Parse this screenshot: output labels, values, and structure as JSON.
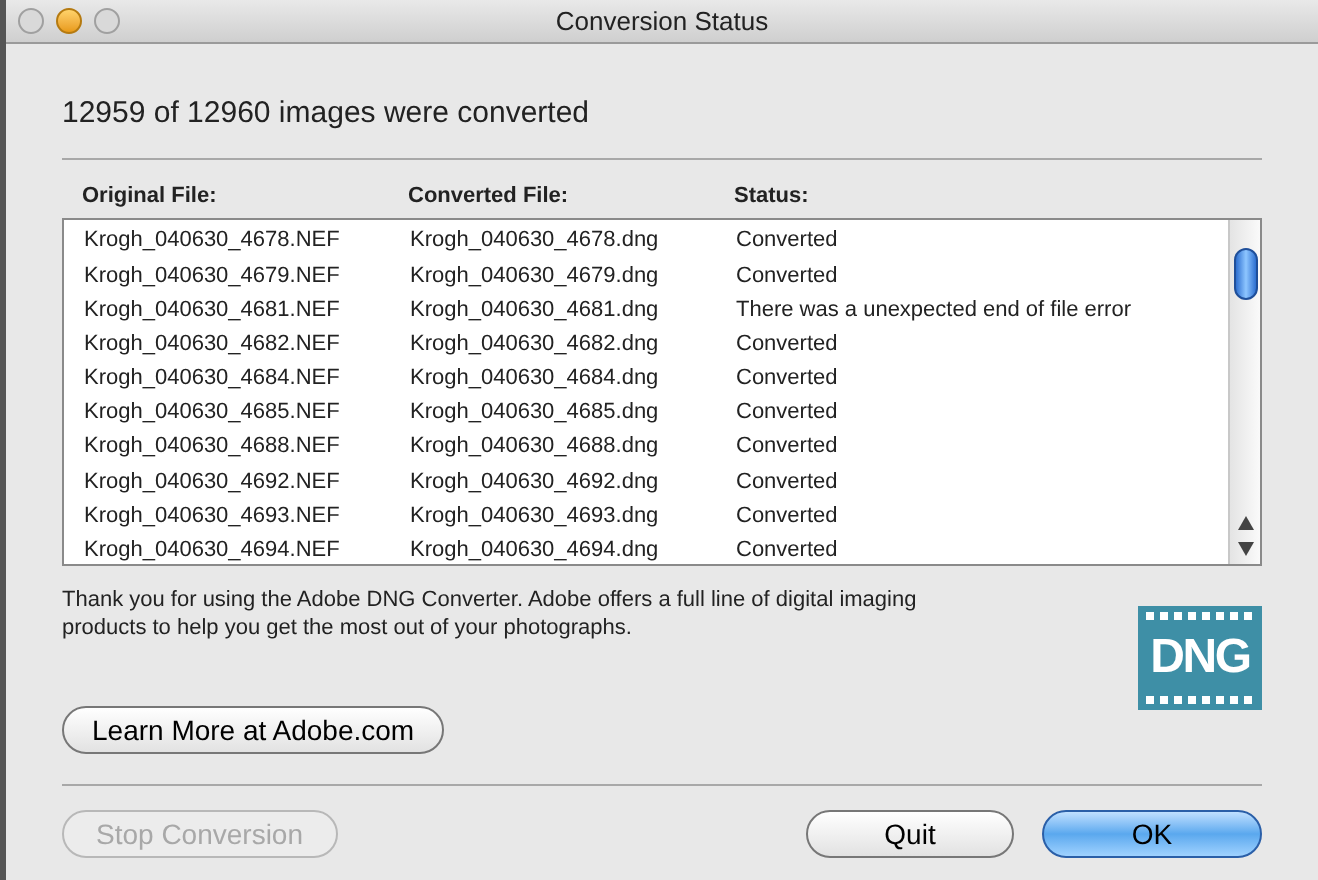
{
  "window": {
    "title": "Conversion Status"
  },
  "summary": "12959 of 12960 images were converted",
  "table": {
    "columns": [
      "Original File:",
      "Converted File:",
      "Status:"
    ],
    "rows": [
      [
        "Krogh_040630_4678.NEF",
        "Krogh_040630_4678.dng",
        "Converted"
      ],
      [
        "Krogh_040630_4679.NEF",
        "Krogh_040630_4679.dng",
        "Converted"
      ],
      [
        "Krogh_040630_4681.NEF",
        "Krogh_040630_4681.dng",
        "There was a unexpected end of file error"
      ],
      [
        "Krogh_040630_4682.NEF",
        "Krogh_040630_4682.dng",
        "Converted"
      ],
      [
        "Krogh_040630_4684.NEF",
        "Krogh_040630_4684.dng",
        "Converted"
      ],
      [
        "Krogh_040630_4685.NEF",
        "Krogh_040630_4685.dng",
        "Converted"
      ],
      [
        "Krogh_040630_4688.NEF",
        "Krogh_040630_4688.dng",
        "Converted"
      ],
      [
        "Krogh_040630_4692.NEF",
        "Krogh_040630_4692.dng",
        "Converted"
      ],
      [
        "Krogh_040630_4693.NEF",
        "Krogh_040630_4693.dng",
        "Converted"
      ],
      [
        "Krogh_040630_4694.NEF",
        "Krogh_040630_4694.dng",
        "Converted"
      ]
    ]
  },
  "message": "Thank you for using the Adobe DNG Converter.  Adobe offers a full line of digital imaging products to help you get the most out of your photographs.",
  "logo": "DNG",
  "learn_more": {
    "label": "Learn More at Adobe.com",
    "disabled": false
  },
  "buttons": [
    {
      "label": "Stop Conversion",
      "disabled": true,
      "default": false
    },
    {
      "label": "Quit",
      "disabled": false,
      "default": false
    },
    {
      "label": "OK",
      "disabled": false,
      "default": true
    }
  ]
}
